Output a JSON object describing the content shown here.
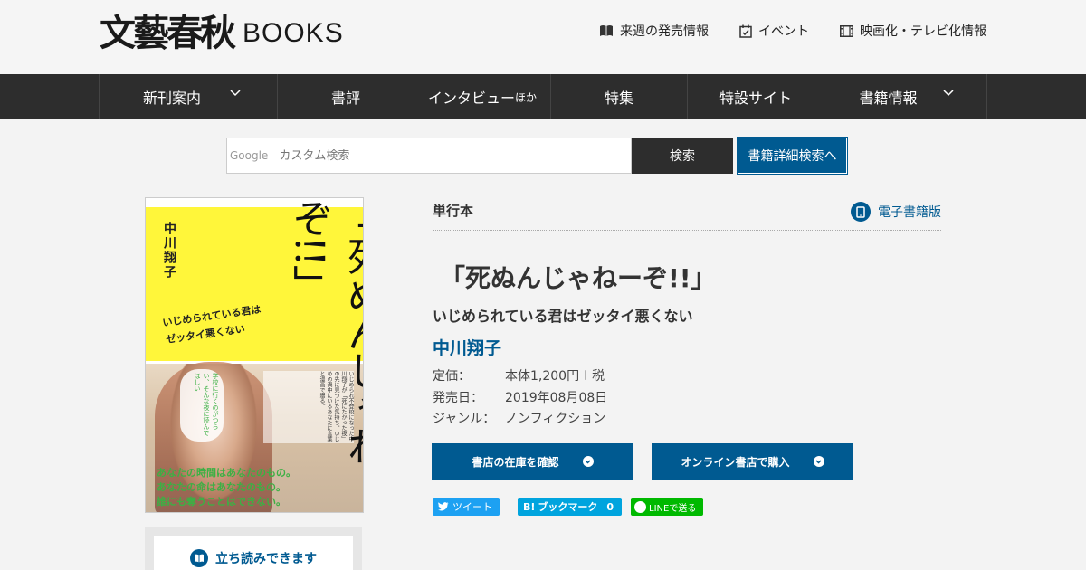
{
  "header": {
    "logo_kanji": "文藝春秋",
    "logo_books": "BOOKS",
    "links": [
      {
        "label": "来週の発売情報",
        "icon": "book-open-icon"
      },
      {
        "label": "イベント",
        "icon": "calendar-check-icon"
      },
      {
        "label": "映画化・テレビ化情報",
        "icon": "film-icon"
      }
    ]
  },
  "nav": {
    "items": [
      {
        "label": "新刊案内",
        "dropdown": true
      },
      {
        "label": "書評",
        "dropdown": false
      },
      {
        "label": "インタビュー",
        "suffix": "ほか",
        "dropdown": false
      },
      {
        "label": "特集",
        "dropdown": false
      },
      {
        "label": "特設サイト",
        "dropdown": false
      },
      {
        "label": "書籍情報",
        "dropdown": true
      }
    ]
  },
  "search": {
    "google_label": "Google",
    "placeholder": "カスタム検索",
    "button_label": "検索",
    "detail_button_label": "書籍詳細検索へ"
  },
  "cover": {
    "author": "中川翔子",
    "subtitle_line1": "いじめられている君は",
    "subtitle_line2": "ゼッタイ悪くない",
    "title": "「死ぬんじゃねーぞ!!」",
    "green_line1": "あなたの時間はあなたのもの。",
    "green_line2": "あなたの命はあなたのもの。",
    "green_line3": "誰にも奪うことはできない。",
    "small_text": "いじめられ不登校になった中川翔子が「死にたかった夜」の先に見つけた気持ち。いじめの渦中にいるあなたに言葉と漫画で贈る。",
    "balloon": "学校に行くのがつらい、そんな夜に読んでほしい"
  },
  "tachiyomi": {
    "label": "立ち読みできます",
    "icon": "book-icon"
  },
  "book": {
    "category": "単行本",
    "ebook_label": "電子書籍版",
    "title": "「死ぬんじゃねーぞ!!」",
    "subtitle": "いじめられている君はゼッタイ悪くない",
    "author": "中川翔子",
    "meta": [
      {
        "key": "定価：",
        "value": "本体1,200円＋税"
      },
      {
        "key": "発売日：",
        "value": "2019年08月08日"
      },
      {
        "key": "ジャンル：",
        "value": "ノンフィクション"
      }
    ]
  },
  "buttons": {
    "stock": "書店の在庫を確認",
    "online": "オンライン書店で購入"
  },
  "share": {
    "tweet": "ツイート",
    "hatena_prefix": "B!",
    "hatena": "ブックマーク",
    "hatena_count": "0",
    "line": "LINEで送る"
  },
  "colors": {
    "accent": "#005a91",
    "nav_bg": "#2d2d2d",
    "twitter": "#1da1f2",
    "hatena": "#00a4de",
    "line": "#00b900",
    "cover_yellow": "#fff63a"
  }
}
